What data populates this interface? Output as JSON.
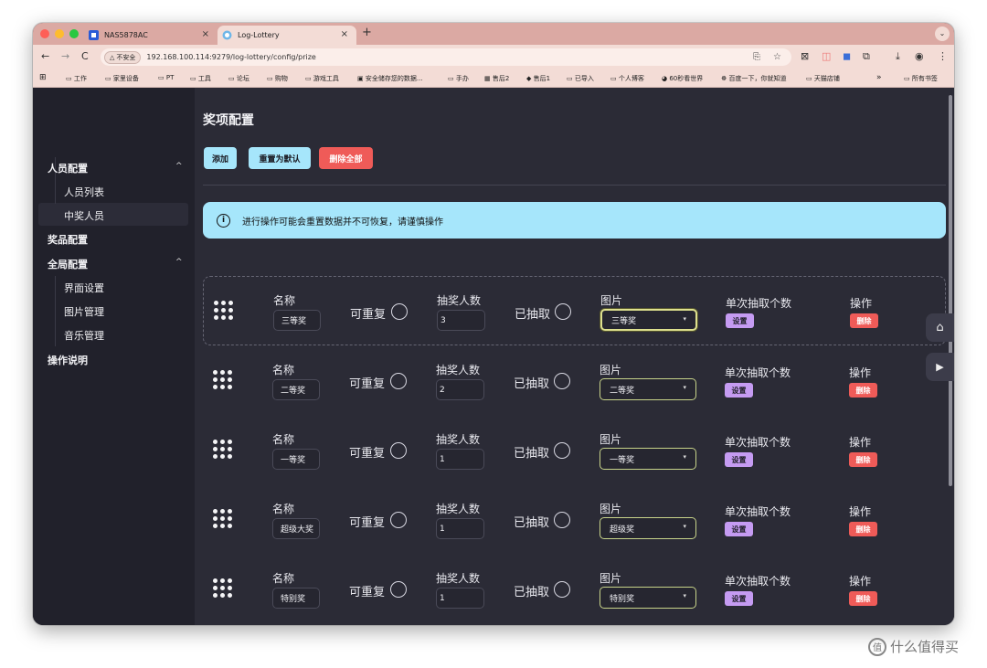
{
  "browser": {
    "tabs": [
      {
        "title": "NAS5878AC",
        "active": false
      },
      {
        "title": "Log-Lottery",
        "active": true
      }
    ],
    "security_label": "不安全",
    "url": "192.168.100.114:9279/log-lottery/config/prize",
    "bookmarks": [
      "工作",
      "家里设备",
      "PT",
      "工具",
      "论坛",
      "购物",
      "游戏工具",
      "安全储存您的数据...",
      "手办",
      "售后2",
      "售后1",
      "已导入",
      "个人博客",
      "60秒看世界",
      "百度一下，你就知道",
      "天猫店铺"
    ],
    "bookmarks_more": "»",
    "all_bookmarks": "所有书签"
  },
  "sidebar": {
    "groups": [
      {
        "label": "人员配置",
        "expanded": true,
        "items": [
          "人员列表",
          "中奖人员"
        ]
      },
      {
        "label": "奖品配置",
        "active": true
      },
      {
        "label": "全局配置",
        "expanded": true,
        "items": [
          "界面设置",
          "图片管理",
          "音乐管理"
        ]
      },
      {
        "label": "操作说明"
      }
    ]
  },
  "main": {
    "title": "奖项配置",
    "buttons": {
      "add": "添加",
      "reset": "重置为默认",
      "delete_all": "删除全部"
    },
    "alert": "进行操作可能会重置数据并不可恢复，请谨慎操作",
    "labels": {
      "name": "名称",
      "repeatable": "可重复",
      "count": "抽奖人数",
      "drawn": "已抽取",
      "image": "图片",
      "per_draw": "单次抽取个数",
      "actions": "操作",
      "settings": "设置",
      "delete": "删除"
    },
    "prizes": [
      {
        "name": "三等奖",
        "count": "3",
        "image": "三等奖"
      },
      {
        "name": "二等奖",
        "count": "2",
        "image": "二等奖"
      },
      {
        "name": "一等奖",
        "count": "1",
        "image": "一等奖"
      },
      {
        "name": "超级大奖",
        "count": "1",
        "image": "超级奖"
      },
      {
        "name": "特别奖",
        "count": "1",
        "image": "特别奖"
      }
    ]
  },
  "watermark": "什么值得买",
  "colors": {
    "accent_blue": "#a6e6fb",
    "danger": "#ef5b58",
    "purple": "#c59bf2",
    "select_border": "#dde08e"
  }
}
